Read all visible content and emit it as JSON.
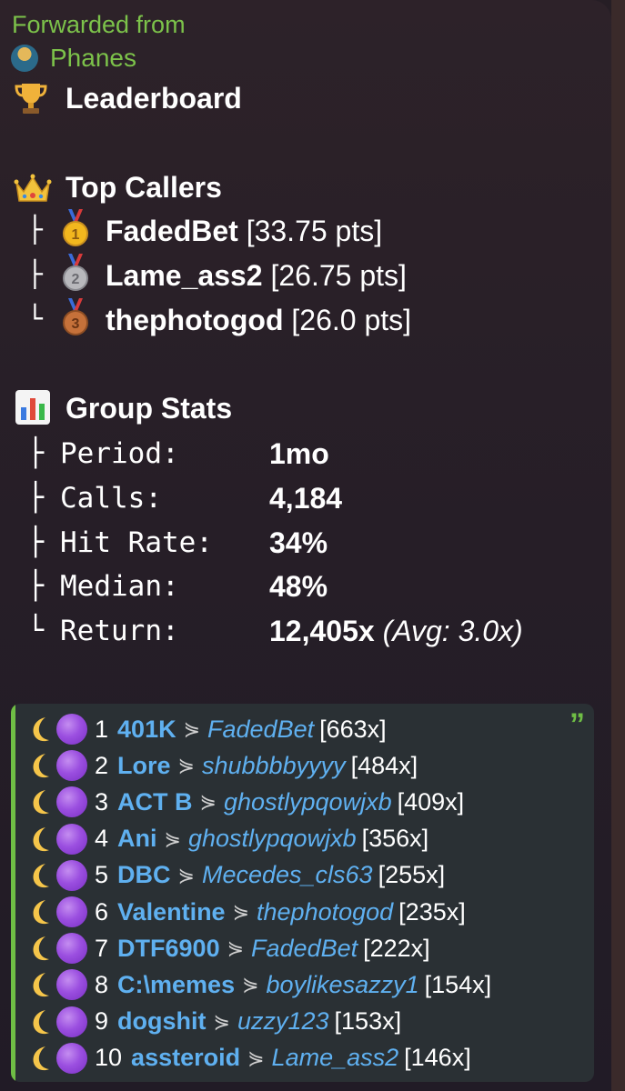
{
  "forward": {
    "label": "Forwarded from",
    "name": "Phanes"
  },
  "leaderboard": {
    "title": "Leaderboard"
  },
  "top_callers": {
    "title": "Top Callers",
    "items": [
      {
        "tree": "├",
        "medal": "1",
        "name": "FadedBet",
        "pts": "[33.75 pts]"
      },
      {
        "tree": "├",
        "medal": "2",
        "name": "Lame_ass2",
        "pts": "[26.75 pts]"
      },
      {
        "tree": "└",
        "medal": "3",
        "name": "thephotogod",
        "pts": "[26.0 pts]"
      }
    ]
  },
  "group_stats": {
    "title": "Group Stats",
    "rows": [
      {
        "tree": "├",
        "label": "Period:",
        "value": "1mo"
      },
      {
        "tree": "├",
        "label": "Calls:",
        "value": "4,184"
      },
      {
        "tree": "├",
        "label": "Hit Rate:",
        "value": "34%"
      },
      {
        "tree": "├",
        "label": "Median:",
        "value": "48%"
      },
      {
        "tree": "└",
        "label": "Return:",
        "value": "12,405x",
        "extra": "(Avg: 3.0x)"
      }
    ]
  },
  "quote": {
    "mark": "”",
    "rows": [
      {
        "rank": "1",
        "token": "401K",
        "user": "FadedBet",
        "mult": "[663x]"
      },
      {
        "rank": "2",
        "token": "Lore",
        "user": "shubbbbyyyy",
        "mult": "[484x]"
      },
      {
        "rank": "3",
        "token": "ACT B",
        "user": "ghostlypqowjxb",
        "mult": "[409x]"
      },
      {
        "rank": "4",
        "token": "Ani",
        "user": "ghostlypqowjxb",
        "mult": "[356x]"
      },
      {
        "rank": "5",
        "token": "DBC",
        "user": "Mecedes_cls63",
        "mult": "[255x]"
      },
      {
        "rank": "6",
        "token": "Valentine",
        "user": "thephotogod",
        "mult": "[235x]"
      },
      {
        "rank": "7",
        "token": "DTF6900",
        "user": "FadedBet",
        "mult": "[222x]"
      },
      {
        "rank": "8",
        "token": "C:\\memes",
        "user": "boylikesazzy1",
        "mult": "[154x]"
      },
      {
        "rank": "9",
        "token": "dogshit",
        "user": "uzzy123",
        "mult": "[153x]"
      },
      {
        "rank": "10",
        "token": "assteroid",
        "user": "Lame_ass2",
        "mult": "[146x]"
      }
    ],
    "arrow": "⋟"
  },
  "colors": {
    "accent_green": "#7cc24a",
    "link_blue": "#5fb0f0",
    "quote_bg": "#2a3034"
  },
  "icons": [
    "trophy-icon",
    "crown-icon",
    "bar-chart-icon",
    "medal-icon",
    "crescent-moon-icon",
    "purple-circle-icon"
  ]
}
